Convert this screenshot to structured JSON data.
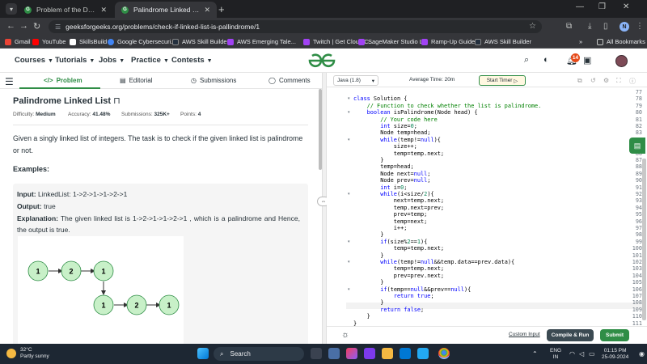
{
  "browser": {
    "tabs": [
      {
        "title": "Problem of the Day | GeeksforG",
        "active": false
      },
      {
        "title": "Palindrome Linked List | Practic",
        "active": true
      }
    ],
    "url": "geeksforgeeks.org/problems/check-if-linked-list-is-pallindrome/1",
    "profile_initial": "N",
    "bookmarks": [
      {
        "label": "Gmail",
        "color": "#ea4335"
      },
      {
        "label": "YouTube",
        "color": "#ff0000"
      },
      {
        "label": "SkillsBuild",
        "color": "#ffffff"
      },
      {
        "label": "Google Cybersecuri...",
        "color": "#4285f4"
      },
      {
        "label": "AWS Skill Builder",
        "color": "#232f3e"
      },
      {
        "label": "AWS Emerging Tale...",
        "color": "#a142f4"
      },
      {
        "label": "Twitch | Get Cloud C...",
        "color": "#a142f4"
      },
      {
        "label": "SageMaker Studio L...",
        "color": "#a142f4"
      },
      {
        "label": "Ramp-Up Guides",
        "color": "#a142f4"
      },
      {
        "label": "AWS Skill Builder",
        "color": "#232f3e"
      }
    ],
    "all_bookmarks": "All Bookmarks"
  },
  "header": {
    "menu": [
      "Courses",
      "Tutorials",
      "Jobs",
      "Practice",
      "Contests"
    ],
    "notification_count": "14"
  },
  "left_tabs": [
    "Problem",
    "Editorial",
    "Submissions",
    "Comments"
  ],
  "problem": {
    "title": "Palindrome Linked List",
    "difficulty_label": "Difficulty:",
    "difficulty": "Medium",
    "accuracy_label": "Accuracy:",
    "accuracy": "41.48%",
    "submissions_label": "Submissions:",
    "submissions": "325K+",
    "points_label": "Points:",
    "points": "4",
    "description": "Given a singly linked list of integers. The task is to check if the given linked list is palindrome or not.",
    "examples_heading": "Examples:",
    "example": {
      "input_label": "Input:",
      "input": "LinkedList: 1->2->1->1->2->1",
      "output_label": "Output:",
      "output": "true",
      "explanation_label": "Explanation:",
      "explanation": "The given linked list is 1->2->1->1->2->1 , which is a palindrome and Hence, the output is true."
    },
    "diagram_nodes": [
      "1",
      "2",
      "1",
      "1",
      "2",
      "1"
    ]
  },
  "editor": {
    "language": "Java (1.8)",
    "avg_time": "Average Time: 20m",
    "start_timer": "Start Timer",
    "lines": [
      {
        "n": "77",
        "code": ""
      },
      {
        "n": "78",
        "code": "class Solution {",
        "fold": true
      },
      {
        "n": "79",
        "code": "    // Function to check whether the list is palindrome."
      },
      {
        "n": "80",
        "code": "    boolean isPalindrome(Node head) {",
        "fold": true
      },
      {
        "n": "81",
        "code": "        // Your code here"
      },
      {
        "n": "82",
        "code": "        int size=0;"
      },
      {
        "n": "83",
        "code": "        Node temp=head;"
      },
      {
        "n": "84",
        "code": "        while(temp!=null){",
        "fold": true
      },
      {
        "n": "85",
        "code": "            size++;"
      },
      {
        "n": "86",
        "code": "            temp=temp.next;"
      },
      {
        "n": "87",
        "code": "        }"
      },
      {
        "n": "88",
        "code": "        temp=head;"
      },
      {
        "n": "89",
        "code": "        Node next=null;"
      },
      {
        "n": "90",
        "code": "        Node prev=null;"
      },
      {
        "n": "91",
        "code": "        int i=0;"
      },
      {
        "n": "92",
        "code": "        while(i<size/2){",
        "fold": true
      },
      {
        "n": "93",
        "code": "            next=temp.next;"
      },
      {
        "n": "94",
        "code": "            temp.next=prev;"
      },
      {
        "n": "95",
        "code": "            prev=temp;"
      },
      {
        "n": "96",
        "code": "            temp=next;"
      },
      {
        "n": "97",
        "code": "            i++;"
      },
      {
        "n": "98",
        "code": "        }"
      },
      {
        "n": "99",
        "code": "        if(size%2==1){",
        "fold": true
      },
      {
        "n": "100",
        "code": "            temp=temp.next;"
      },
      {
        "n": "101",
        "code": "        }"
      },
      {
        "n": "102",
        "code": "        while(temp!=null&&temp.data==prev.data){",
        "fold": true
      },
      {
        "n": "103",
        "code": "            temp=temp.next;"
      },
      {
        "n": "104",
        "code": "            prev=prev.next;"
      },
      {
        "n": "105",
        "code": "        }"
      },
      {
        "n": "106",
        "code": "        if(temp==null&&prev==null){",
        "fold": true
      },
      {
        "n": "107",
        "code": "            return true;"
      },
      {
        "n": "108",
        "code": "        }"
      },
      {
        "n": "109",
        "code": "        return false;"
      },
      {
        "n": "110",
        "code": "    }"
      },
      {
        "n": "111",
        "code": "}"
      }
    ],
    "custom_input": "Custom Input",
    "compile_run": "Compile & Run",
    "submit": "Submit"
  },
  "taskbar": {
    "weather_temp": "32°C",
    "weather_desc": "Partly sunny",
    "search": "Search",
    "lang_top": "ENG",
    "lang_bottom": "IN",
    "time": "01:15 PM",
    "date": "25-09-2024"
  }
}
